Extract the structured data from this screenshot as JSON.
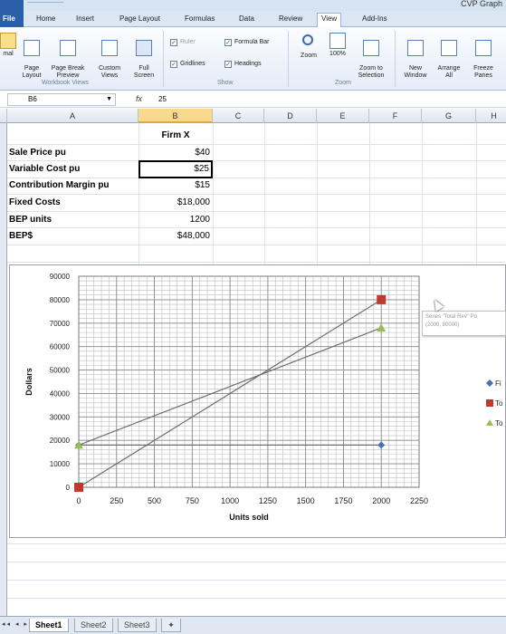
{
  "window": {
    "title": "CVP Graph"
  },
  "ribbon_tabs": [
    {
      "label": "File"
    },
    {
      "label": "Home"
    },
    {
      "label": "Insert"
    },
    {
      "label": "Page Layout"
    },
    {
      "label": "Formulas"
    },
    {
      "label": "Data"
    },
    {
      "label": "Review"
    },
    {
      "label": "View"
    },
    {
      "label": "Add-Ins"
    }
  ],
  "ribbon": {
    "normal": "mal",
    "page_layout": "Page\nLayout",
    "page_break": "Page Break\nPreview",
    "custom_views": "Custom\nViews",
    "full_screen": "Full\nScreen",
    "group_workbook_views": "Workbook Views",
    "ruler": "Ruler",
    "formula_bar": "Formula Bar",
    "gridlines": "Gridlines",
    "headings": "Headings",
    "group_show": "Show",
    "zoom": "Zoom",
    "zoom_100": "100%",
    "zoom_selection": "Zoom to\nSelection",
    "group_zoom": "Zoom",
    "new_window": "New\nWindow",
    "arrange_all": "Arrange\nAll",
    "freeze_panes": "Freeze\nPanes"
  },
  "formula_bar": {
    "name_box": "B6",
    "fx": "fx",
    "content": "25"
  },
  "columns": [
    "A",
    "B",
    "C",
    "D",
    "E",
    "F",
    "G",
    "H"
  ],
  "sheet": {
    "header": "Firm X",
    "rows": [
      {
        "label": "Sale Price pu",
        "value": "$40"
      },
      {
        "label": "Variable Cost pu",
        "value": "$25"
      },
      {
        "label": "Contribution Margin pu",
        "value": "$15"
      },
      {
        "label": "Fixed Costs",
        "value": "$18,000"
      },
      {
        "label": "BEP units",
        "value": "1200"
      },
      {
        "label": "BEP$",
        "value": "$48,000"
      }
    ]
  },
  "chart_data": {
    "type": "scatter",
    "xlabel": "Units sold",
    "ylabel": "Dollars",
    "xlim": [
      0,
      2250
    ],
    "ylim": [
      0,
      90000
    ],
    "x_ticks": [
      0,
      250,
      500,
      750,
      1000,
      1250,
      1500,
      1750,
      2000,
      2250
    ],
    "y_ticks": [
      0,
      10000,
      20000,
      30000,
      40000,
      50000,
      60000,
      70000,
      80000,
      90000
    ],
    "grid": true,
    "legend_position": "right",
    "series": [
      {
        "name": "Fi",
        "color": "#4a6fb5",
        "marker": "diamond",
        "x": [
          0,
          2000
        ],
        "y": [
          18000,
          18000
        ]
      },
      {
        "name": "To",
        "color": "#c0392b",
        "marker": "square",
        "x": [
          0,
          2000
        ],
        "y": [
          0,
          80000
        ]
      },
      {
        "name": "To",
        "color": "#9bbb59",
        "marker": "triangle",
        "x": [
          0,
          2000
        ],
        "y": [
          18000,
          68000
        ]
      }
    ]
  },
  "tooltip": {
    "line1": "Series \"Total Rev\" Po",
    "line2": "(2000, 80000)"
  },
  "sheet_tabs": [
    {
      "label": "Sheet1"
    },
    {
      "label": "Sheet2"
    },
    {
      "label": "Sheet3"
    }
  ]
}
